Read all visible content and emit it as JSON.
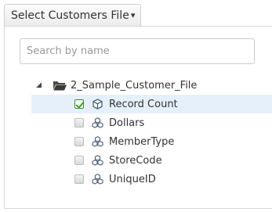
{
  "dropdown": {
    "label": "Select Customers File",
    "caret": "▾"
  },
  "search": {
    "placeholder": "Search by name",
    "value": ""
  },
  "tree": {
    "root": {
      "label": "2_Sample_Customer_File",
      "toggle": "◢",
      "icon": "folder-open-icon"
    },
    "items": [
      {
        "label": "Record Count",
        "checked": true,
        "icon": "cube-icon",
        "selected": true
      },
      {
        "label": "Dollars",
        "checked": false,
        "icon": "cubes-icon"
      },
      {
        "label": "MemberType",
        "checked": false,
        "icon": "cubes-icon"
      },
      {
        "label": "StoreCode",
        "checked": false,
        "icon": "cubes-icon"
      },
      {
        "label": "UniqueID",
        "checked": false,
        "icon": "cubes-icon"
      }
    ]
  },
  "colors": {
    "selected_row": "#e6f0fb",
    "check": "#3aa21b",
    "border": "#d6d6d6"
  }
}
